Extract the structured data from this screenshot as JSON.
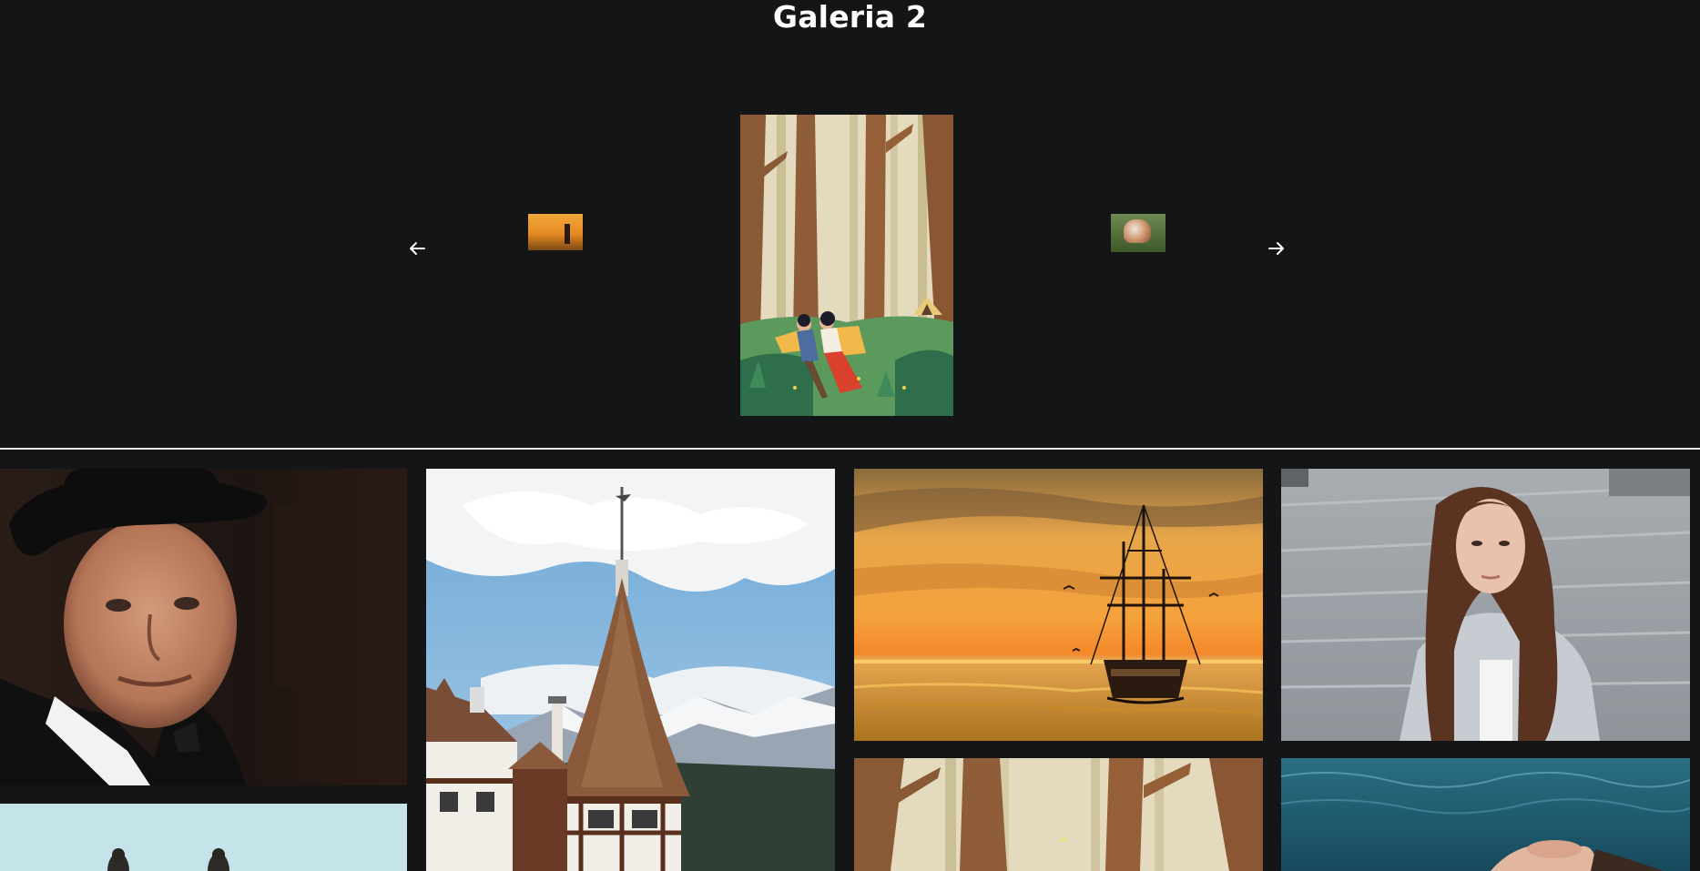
{
  "page": {
    "title": "Galeria 2"
  },
  "carousel": {
    "prev_icon": "arrow-left-icon",
    "next_icon": "arrow-right-icon",
    "slides": [
      {
        "name": "ship-at-sunset",
        "position": "previous"
      },
      {
        "name": "forest-picnic-illustration",
        "position": "current"
      },
      {
        "name": "dogs-on-grass",
        "position": "next"
      }
    ]
  },
  "grid": {
    "tiles": [
      {
        "name": "man-in-top-hat"
      },
      {
        "name": "couple-on-beach"
      },
      {
        "name": "church-spire-mountains"
      },
      {
        "name": "ship-at-sunset"
      },
      {
        "name": "forest-picnic-illustration"
      },
      {
        "name": "woman-on-pier"
      },
      {
        "name": "woman-floating-in-water"
      }
    ]
  },
  "colors": {
    "background": "#141517",
    "text": "#ffffff",
    "divider": "#e9e9e9"
  }
}
